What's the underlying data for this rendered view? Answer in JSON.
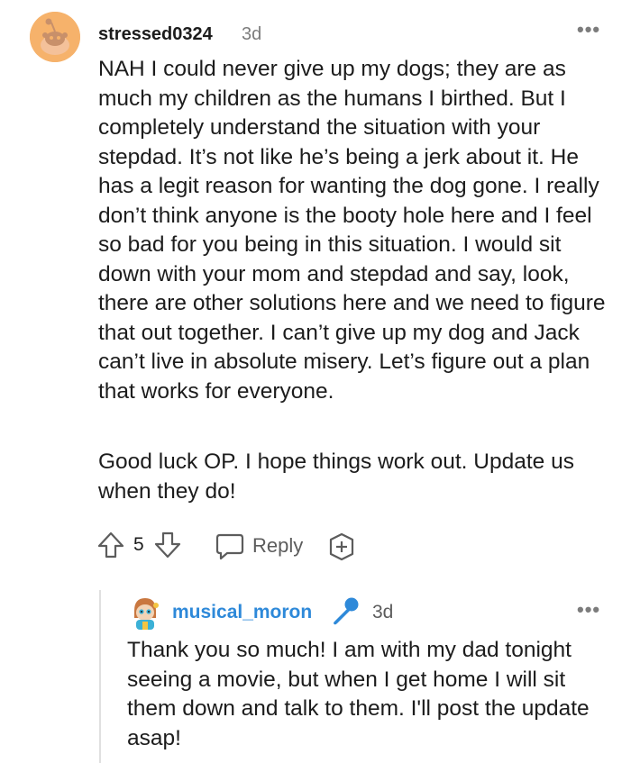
{
  "comment": {
    "username": "stressed0324",
    "time": "3d",
    "more_icon": "•••",
    "paragraphs": [
      "NAH I could never give up my dogs; they are as much my children as the humans I birthed. But I completely understand the situation with your stepdad. It’s not like he’s being a jerk about it. He has a legit reason for wanting the dog gone. I really don’t think anyone is the booty hole here and I feel so bad for you being in this situation. I would sit down with your mom and stepdad and say, look, there are other solutions here and we need to figure that out together. I can’t give up my dog and Jack can’t live in absolute misery. Let’s figure out a plan that works for everyone.",
      "Good luck OP. I hope things work out. Update us when they do!"
    ],
    "votes": "5",
    "reply_label": "Reply",
    "avatar_color": "#f6b26b"
  },
  "reply": {
    "username": "musical_moron",
    "time": "3d",
    "more_icon": "•••",
    "text": "Thank you so much! I am with my dad tonight seeing a movie, but when I get home I will sit them down and talk to them. I'll post the update asap!",
    "username_color": "#2e89d9",
    "flair_icon": "microphone-icon"
  }
}
